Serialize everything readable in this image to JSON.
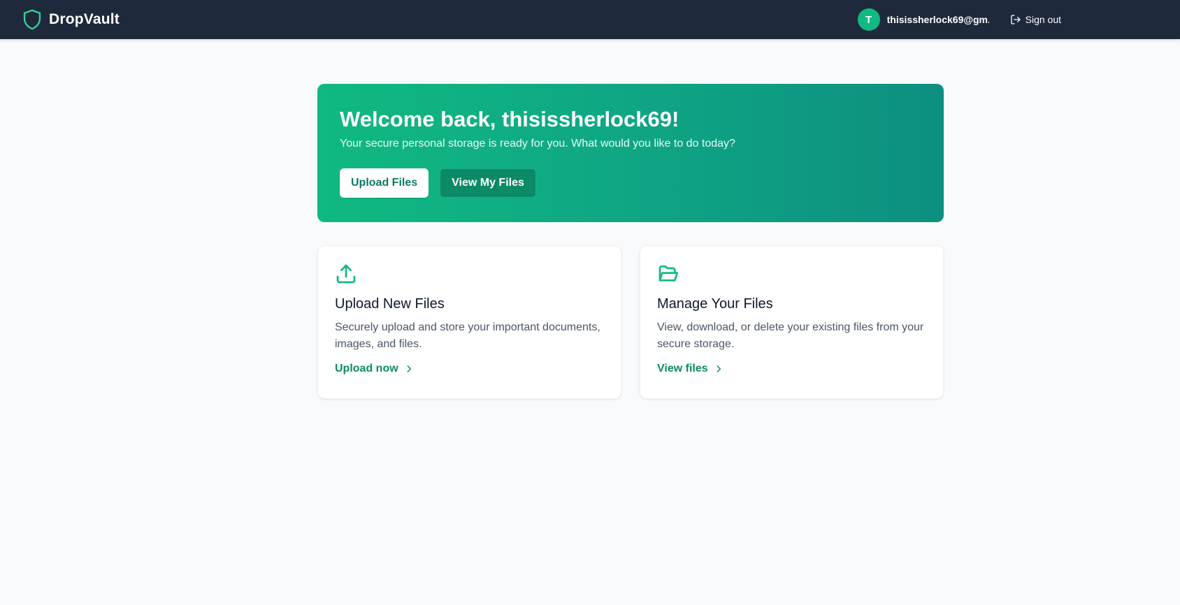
{
  "navbar": {
    "brand_name": "DropVault",
    "brand_icon": "shield-icon",
    "user": {
      "avatar_initial": "T",
      "email": "thisissherlock69@gm..."
    },
    "signout_label": "Sign out",
    "signout_icon": "sign-out-icon"
  },
  "hero": {
    "title": "Welcome back, thisissherlock69!",
    "subtitle": "Your secure personal storage is ready for you. What would you like to do today?",
    "primary_button": "Upload Files",
    "secondary_button": "View My Files"
  },
  "cards": [
    {
      "icon": "upload-icon",
      "title": "Upload New Files",
      "description": "Securely upload and store your important documents, images, and files.",
      "link_label": "Upload now"
    },
    {
      "icon": "folder-open-icon",
      "title": "Manage Your Files",
      "description": "View, download, or delete your existing files from your secure storage.",
      "link_label": "View files"
    }
  ],
  "colors": {
    "navbar_bg": "#1e293b",
    "accent": "#10b981",
    "accent_dark": "#0b8a66",
    "page_bg": "#f8fafc"
  }
}
